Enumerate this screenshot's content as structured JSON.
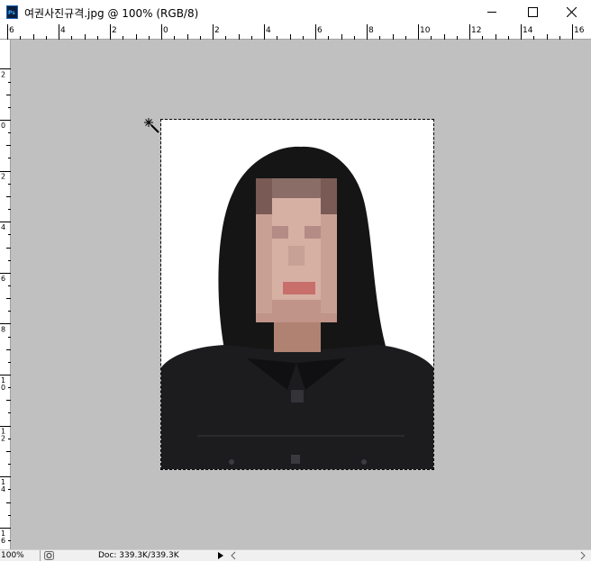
{
  "window": {
    "title": "여권사진규격.jpg @ 100% (RGB/8)",
    "app_icon_text": "Ps"
  },
  "ruler": {
    "horizontal_labels": [
      "6",
      "4",
      "2",
      "0",
      "2",
      "4",
      "6",
      "8",
      "10",
      "12",
      "14",
      "16"
    ],
    "vertical_labels": [
      "2",
      "0",
      "2",
      "4",
      "6",
      "8",
      "10",
      "12",
      "14",
      "16"
    ]
  },
  "canvas": {
    "background": "#c0c0c0",
    "document_background": "#ffffff"
  },
  "status": {
    "zoom": "100%",
    "doc_info": "Doc: 339.3K/339.3K"
  }
}
